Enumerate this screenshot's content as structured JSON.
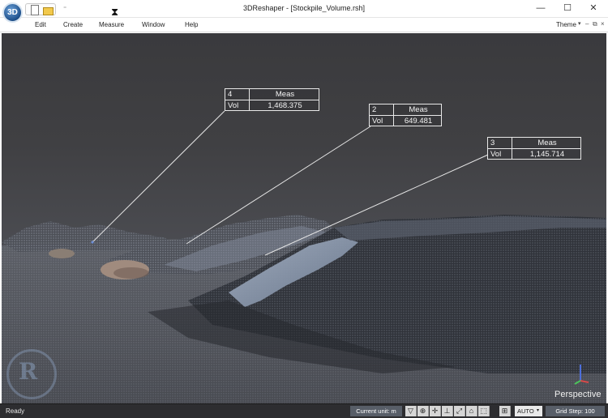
{
  "app": {
    "logo": "3D",
    "title": "3DReshaper - [Stockpile_Volume.rsh]",
    "icons": [
      "new-file-icon",
      "open-folder-icon",
      "hourglass-cursor-icon"
    ]
  },
  "quick_access": {
    "dropdown": "⁼"
  },
  "window_controls": {
    "minimize": "—",
    "maximize": "☐",
    "close": "✕"
  },
  "menu": {
    "items": [
      "Edit",
      "Create",
      "Measure",
      "Window",
      "Help"
    ],
    "theme": "Theme",
    "theme_caret": "▾",
    "mini_controls": [
      "–",
      "⧉",
      "×"
    ]
  },
  "measurements": [
    {
      "id": "4",
      "header": "Meas",
      "label": "Vol",
      "value": "1,468.375"
    },
    {
      "id": "2",
      "header": "Meas",
      "label": "Vol",
      "value": "649.481"
    },
    {
      "id": "3",
      "header": "Meas",
      "label": "Vol",
      "value": "1,145.714"
    }
  ],
  "viewport": {
    "mode": "Perspective"
  },
  "statusbar": {
    "ready": "Ready",
    "current_unit": "Current unit: m",
    "tools": [
      "▽",
      "⊕",
      "✛",
      "⊥",
      "⤢",
      "⌂",
      "⬚",
      "⊞"
    ],
    "auto": "AUTO",
    "auto_caret": "▾",
    "grid_step": "Grid Step: 100"
  },
  "colors": {
    "sky_top": "#3a3a3d",
    "ground": "#5c5f66",
    "stockpile_highlight": "#8d9bb0",
    "status_bg": "#2d2d30"
  }
}
